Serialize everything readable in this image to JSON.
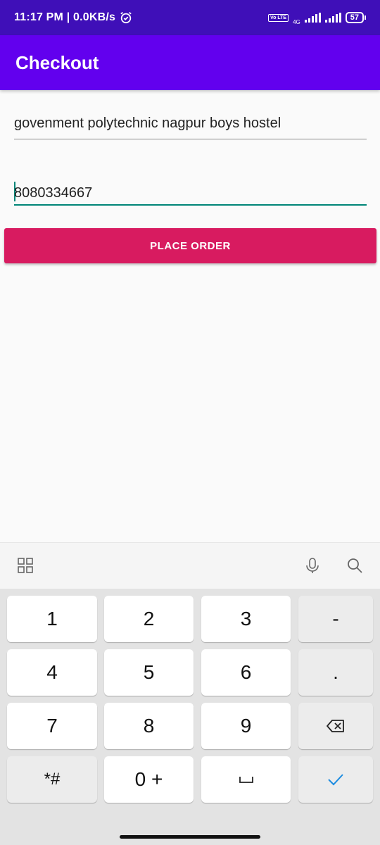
{
  "status_bar": {
    "time_speed": "11:17 PM | 0.0KB/s",
    "volte": "Vo LTE",
    "network": "4G",
    "battery": "57"
  },
  "app_bar": {
    "title": "Checkout"
  },
  "form": {
    "address_value": "govenment polytechnic nagpur boys hostel",
    "phone_value": "8080334667",
    "place_order_label": "PLACE ORDER"
  },
  "keyboard": {
    "keys": {
      "k1": "1",
      "k2": "2",
      "k3": "3",
      "dash": "-",
      "k4": "4",
      "k5": "5",
      "k6": "6",
      "dot": ".",
      "k7": "7",
      "k8": "8",
      "k9": "9",
      "star_hash": "*#",
      "zero_plus": "0 +"
    },
    "icons": {
      "grid": "grid-icon",
      "mic": "microphone-icon",
      "search": "search-icon",
      "backspace": "backspace-icon",
      "space": "space-icon",
      "done": "checkmark-icon"
    }
  }
}
